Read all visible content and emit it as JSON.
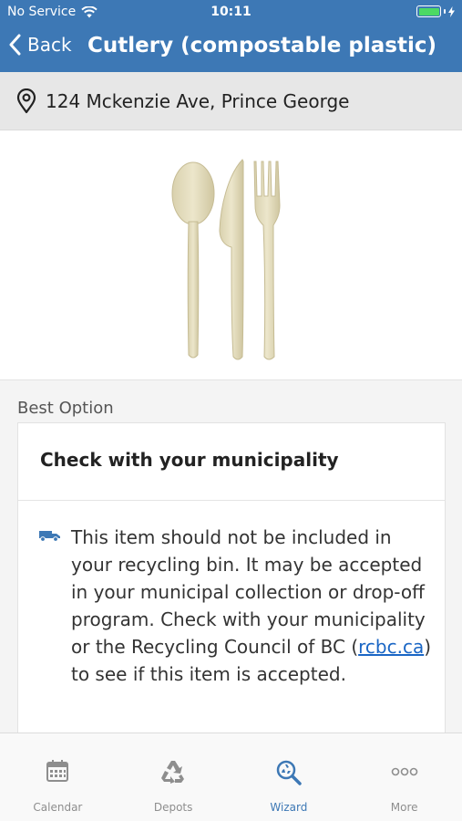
{
  "status_bar": {
    "carrier": "No Service",
    "time": "10:11",
    "battery_level": 1.0,
    "battery_color": "#4cd964"
  },
  "nav": {
    "back_label": "Back",
    "title": "Cutlery (compostable plastic)",
    "bar_color": "#3d78b5"
  },
  "address": {
    "icon": "location-pin-icon",
    "text": "124 Mckenzie Ave, Prince George"
  },
  "item_image": {
    "icon": "compostable-cutlery-illustration"
  },
  "best_option": {
    "section_label": "Best Option",
    "card_title": "Check with your municipality",
    "icon": "truck-icon",
    "text_before_link": "This item should not be included in your recycling bin. It may be accepted in your municipal collection or drop-off program. Check with your municipality or the Recycling Council of BC (",
    "link_text": "rcbc.ca",
    "text_after_link": ") to see if this item is accepted."
  },
  "tabs": [
    {
      "label": "Calendar",
      "icon": "calendar-icon",
      "active": false
    },
    {
      "label": "Depots",
      "icon": "recycle-icon",
      "active": false
    },
    {
      "label": "Wizard",
      "icon": "wizard-search-icon",
      "active": true
    },
    {
      "label": "More",
      "icon": "more-dots-icon",
      "active": false
    }
  ],
  "colors": {
    "accent": "#3d78b5",
    "link": "#1a66c5",
    "inactive_tab": "#8e8e8e"
  }
}
